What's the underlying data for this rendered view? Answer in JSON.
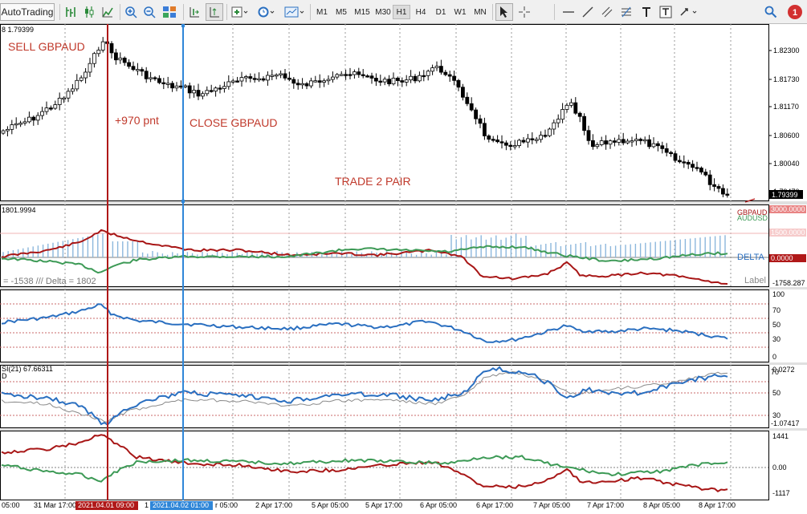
{
  "toolbar": {
    "autotrading_label": "AutoTrading",
    "timeframes": [
      "M1",
      "M5",
      "M15",
      "M30",
      "H1",
      "H4",
      "D1",
      "W1",
      "MN"
    ],
    "active_timeframe": "H1",
    "notification_count": "1"
  },
  "main_chart": {
    "info": "8 1.79399",
    "price_labels": [
      "1.82300",
      "1.81730",
      "1.81170",
      "1.80600",
      "1.80040",
      "1.79470"
    ],
    "current_price": "1.79399",
    "annotations": {
      "sell": "SELL GBPAUD",
      "profit": "+970 pnt",
      "close": "CLOSE GBPAUD",
      "trade": "TRADE 2 PAIR"
    }
  },
  "delta_panel": {
    "info": "1801.9994",
    "stats": "= -1538 /// Delta = 1802",
    "legend": [
      "GBPAUD",
      "AUDUSD"
    ],
    "delta_label": "DELTA",
    "label_text": "Label",
    "scale": [
      "3000.0000",
      "1500.0000",
      "0.0000",
      "-1758.287"
    ]
  },
  "osc_panel": {
    "scale": [
      "100",
      "70",
      "50",
      "30",
      "0"
    ]
  },
  "rsi_panel": {
    "info": "SI(21) 67.66311",
    "info2": "D",
    "scale": [
      "0.0272",
      "70",
      "50",
      "30",
      "-1.07417"
    ]
  },
  "bottom_panel": {
    "scale": [
      "1441",
      "0.00",
      "-1117"
    ]
  },
  "time_axis": {
    "labels": [
      "05:00",
      "31 Mar 17:00",
      "2021.04.01 09:00",
      "1",
      "2021.04.02 01:00",
      "r 05:00",
      "2 Apr 17:00",
      "5 Apr 05:00",
      "5 Apr 17:00",
      "6 Apr 05:00",
      "6 Apr 17:00",
      "7 Apr 05:00",
      "7 Apr 17:00",
      "8 Apr 05:00",
      "8 Apr 17:00"
    ]
  },
  "colors": {
    "red_marker": "#b01818",
    "blue_marker": "#2f86d8",
    "annotation": "#c0392b",
    "line_red": "#a81616",
    "line_green": "#3d9a56",
    "line_blue": "#2a6fc0"
  }
}
